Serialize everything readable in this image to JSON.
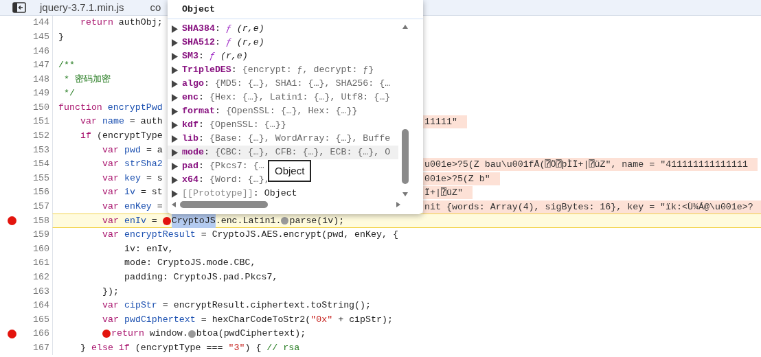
{
  "tabs": [
    {
      "label": "jquery-3.7.1.min.js"
    },
    {
      "label": "co"
    }
  ],
  "code_lines": [
    {
      "number": "144",
      "kind": "level1",
      "breakpoint": false,
      "paused": false,
      "segments": [
        {
          "kind": "kw",
          "t": "return"
        },
        {
          "kind": "p",
          "t": " authObj;"
        }
      ]
    },
    {
      "number": "145",
      "kind": "level0",
      "breakpoint": false,
      "paused": false,
      "segments": [
        {
          "kind": "p",
          "t": "}"
        }
      ]
    },
    {
      "number": "146",
      "kind": "level0",
      "breakpoint": false,
      "paused": false
    },
    {
      "number": "147",
      "kind": "level0",
      "breakpoint": false,
      "paused": false,
      "segments": [
        {
          "kind": "cm",
          "t": "/**"
        }
      ]
    },
    {
      "number": "148",
      "kind": "comment",
      "breakpoint": false,
      "paused": false,
      "segments": [
        {
          "kind": "cm",
          "t": "* 密码加密"
        }
      ]
    },
    {
      "number": "149",
      "kind": "comment",
      "breakpoint": false,
      "paused": false,
      "segments": [
        {
          "kind": "cm",
          "t": "*/"
        }
      ]
    },
    {
      "number": "150",
      "kind": "level0",
      "breakpoint": false,
      "paused": false,
      "segments": [
        {
          "kind": "kw",
          "t": "function"
        },
        {
          "kind": "def",
          "t": "encryptPwd"
        }
      ]
    },
    {
      "number": "151",
      "kind": "level1",
      "breakpoint": false,
      "paused": false,
      "segments": [
        {
          "kind": "kw",
          "t": "var"
        },
        {
          "kind": "def",
          "t": "name"
        },
        {
          "kind": "p",
          "t": " = auth"
        }
      ],
      "inline_value": "11111\""
    },
    {
      "number": "152",
      "kind": "level1",
      "breakpoint": false,
      "paused": false,
      "segments": [
        {
          "kind": "kw",
          "t": "if"
        },
        {
          "kind": "p",
          "t": " (encryptType"
        }
      ]
    },
    {
      "number": "153",
      "kind": "level2",
      "breakpoint": false,
      "paused": false,
      "segments": [
        {
          "kind": "kw",
          "t": "var"
        },
        {
          "kind": "def",
          "t": "pwd"
        },
        {
          "kind": "p",
          "t": " = a"
        }
      ]
    },
    {
      "number": "154",
      "kind": "level2",
      "breakpoint": false,
      "paused": false,
      "segments": [
        {
          "kind": "kw",
          "t": "var"
        },
        {
          "kind": "def",
          "t": "strSha2"
        }
      ],
      "inline_value": "u001e>?5(Z bau\\u001fÅ(⍰Ö⍰þÌÏ+|⍰üZ\", name = \"411111111111111"
    },
    {
      "number": "155",
      "kind": "level2",
      "breakpoint": false,
      "paused": false,
      "segments": [
        {
          "kind": "kw",
          "t": "var"
        },
        {
          "kind": "def",
          "t": "key"
        },
        {
          "kind": "p",
          "t": " = s"
        }
      ],
      "inline_value": "001e>?5(Z b\""
    },
    {
      "number": "156",
      "kind": "level2",
      "breakpoint": false,
      "paused": false,
      "segments": [
        {
          "kind": "kw",
          "t": "var"
        },
        {
          "kind": "def",
          "t": "iv"
        },
        {
          "kind": "p",
          "t": " = st"
        }
      ],
      "inline_value": "Ï+|⍰üZ\""
    },
    {
      "number": "157",
      "kind": "level2",
      "breakpoint": false,
      "paused": false,
      "segments": [
        {
          "kind": "kw",
          "t": "var"
        },
        {
          "kind": "def",
          "t": "enKey"
        },
        {
          "kind": "p",
          "t": " ="
        }
      ],
      "inline_value": "nit {words: Array(4), sigBytes: 16}, key = \"ïk:<Ù¾Á@\\u001e>?"
    },
    {
      "number": "158",
      "kind": "level2",
      "breakpoint": true,
      "paused": true,
      "segments": [
        {
          "kind": "kw",
          "t": "var"
        },
        {
          "kind": "def",
          "t": "enIv"
        },
        {
          "kind": "p",
          "t": " = "
        },
        {
          "kind": "bp_on"
        },
        {
          "kind": "sel",
          "t": "CryptoJS"
        },
        {
          "kind": "p",
          "t": ".enc.Latin1."
        },
        {
          "kind": "bp_off"
        },
        {
          "kind": "p",
          "t": "parse(iv);"
        }
      ]
    },
    {
      "number": "159",
      "kind": "level2",
      "breakpoint": false,
      "paused": false,
      "segments": [
        {
          "kind": "kw",
          "t": "var"
        },
        {
          "kind": "def",
          "t": "encryptResult"
        },
        {
          "kind": "p",
          "t": " = CryptoJS.AES.encrypt(pwd, enKey, {"
        }
      ]
    },
    {
      "number": "160",
      "kind": "level3",
      "breakpoint": false,
      "paused": false,
      "segments": [
        {
          "kind": "p",
          "t": "iv: enIv,"
        }
      ]
    },
    {
      "number": "161",
      "kind": "level3",
      "breakpoint": false,
      "paused": false,
      "segments": [
        {
          "kind": "p",
          "t": "mode: CryptoJS.mode.CBC,"
        }
      ]
    },
    {
      "number": "162",
      "kind": "level3",
      "breakpoint": false,
      "paused": false,
      "segments": [
        {
          "kind": "p",
          "t": "padding: CryptoJS.pad.Pkcs7,"
        }
      ]
    },
    {
      "number": "163",
      "kind": "level2",
      "breakpoint": false,
      "paused": false,
      "segments": [
        {
          "kind": "p",
          "t": "});"
        }
      ]
    },
    {
      "number": "164",
      "kind": "level2",
      "breakpoint": false,
      "paused": false,
      "segments": [
        {
          "kind": "kw",
          "t": "var"
        },
        {
          "kind": "def",
          "t": "cipStr"
        },
        {
          "kind": "p",
          "t": " = encryptResult.ciphertext.toString();"
        }
      ]
    },
    {
      "number": "165",
      "kind": "level2",
      "breakpoint": false,
      "paused": false,
      "segments": [
        {
          "kind": "kw",
          "t": "var"
        },
        {
          "kind": "def",
          "t": "pwdCiphertext"
        },
        {
          "kind": "p",
          "t": " = hexCharCodeToStr2("
        },
        {
          "kind": "str",
          "t": "\"0x\""
        },
        {
          "kind": "p",
          "t": " + cipStr);"
        }
      ]
    },
    {
      "number": "166",
      "kind": "level2",
      "breakpoint": true,
      "paused": false,
      "segments": [
        {
          "kind": "bp_on"
        },
        {
          "kind": "kw",
          "t": "return"
        },
        {
          "kind": "p",
          "t": " window."
        },
        {
          "kind": "bp_off"
        },
        {
          "kind": "p",
          "t": "btoa(pwdCiphertext);"
        }
      ]
    },
    {
      "number": "167",
      "kind": "level1",
      "breakpoint": false,
      "paused": false,
      "segments": [
        {
          "kind": "p",
          "t": "} "
        },
        {
          "kind": "kw",
          "t": "else if"
        },
        {
          "kind": "p",
          "t": " (encryptType === "
        },
        {
          "kind": "str",
          "t": "\"3\""
        },
        {
          "kind": "p",
          "t": ") { "
        },
        {
          "kind": "cm",
          "t": "// rsa"
        }
      ]
    }
  ],
  "popover": {
    "title": "Object",
    "rows": [
      {
        "kind": "function",
        "name": "SHA384",
        "sep": ":",
        "f": "ƒ",
        "value": "(r,e)",
        "hovered": false
      },
      {
        "kind": "function",
        "name": "SHA512",
        "sep": ":",
        "f": "ƒ",
        "value": "(r,e)",
        "hovered": false
      },
      {
        "kind": "function",
        "name": "SM3",
        "sep": ":",
        "f": "ƒ",
        "value": "(r,e)",
        "hovered": false
      },
      {
        "kind": "object",
        "name": "TripleDES",
        "sep": ":",
        "value": "{encrypt: ƒ, decrypt: ƒ}",
        "hovered": false
      },
      {
        "kind": "object",
        "name": "algo",
        "sep": ":",
        "value": "{MD5: {…}, SHA1: {…}, SHA256: {…",
        "hovered": false
      },
      {
        "kind": "object",
        "name": "enc",
        "sep": ":",
        "value": "{Hex: {…}, Latin1: {…}, Utf8: {…}",
        "hovered": false
      },
      {
        "kind": "object",
        "name": "format",
        "sep": ":",
        "value": "{OpenSSL: {…}, Hex: {…}}",
        "hovered": false
      },
      {
        "kind": "object",
        "name": "kdf",
        "sep": ":",
        "value": "{OpenSSL: {…}}",
        "hovered": false
      },
      {
        "kind": "object",
        "name": "lib",
        "sep": ":",
        "value": "{Base: {…}, WordArray: {…}, Buffe",
        "hovered": false
      },
      {
        "kind": "object",
        "name": "mode",
        "sep": ":",
        "value": "{CBC: {…}, CFB: {…}, ECB: {…}, O",
        "hovered": true
      },
      {
        "kind": "object",
        "name": "pad",
        "sep": ":",
        "value": "{Pkcs7: {…",
        "hovered": false
      },
      {
        "kind": "object",
        "name": "x64",
        "sep": ":",
        "value": "{Word: {…},",
        "hovered": false
      },
      {
        "kind": "proto",
        "name": "[[Prototype]]",
        "sep": ":",
        "value": "Object",
        "hovered": false
      }
    ],
    "tooltip": "Object"
  }
}
